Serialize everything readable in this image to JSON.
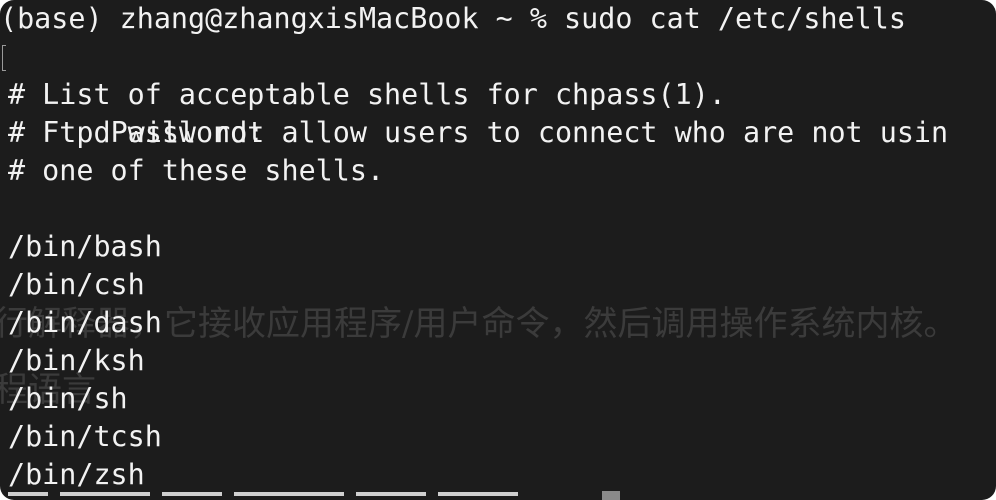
{
  "terminal": {
    "prompt_line": "(base) zhang@zhangxisMacBook ~ % sudo cat /etc/shells",
    "password_prompt": "Password:",
    "lines": [
      "# List of acceptable shells for chpass(1).",
      "# Ftpd will not allow users to connect who are not usin",
      "# one of these shells.",
      "",
      "/bin/bash",
      "/bin/csh",
      "/bin/dash",
      "/bin/ksh",
      "/bin/sh",
      "/bin/tcsh",
      "/bin/zsh"
    ]
  },
  "background_overlay": {
    "line1": "行解释器，它接收应用程序/用户命令，然后调用操作系统内核。",
    "line2": "程语言"
  },
  "colors": {
    "background": "#1c1c1c",
    "text": "#f2f2f2",
    "overlay_text": "#3b3b3b"
  }
}
